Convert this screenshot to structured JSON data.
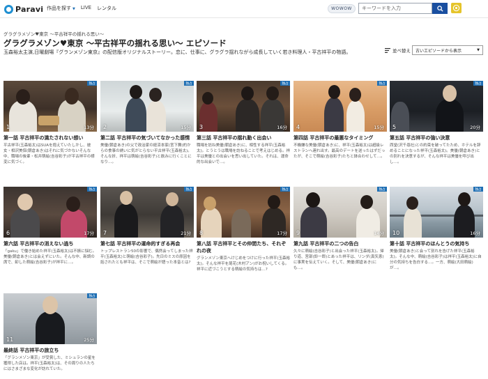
{
  "header": {
    "logo": "Paravi",
    "nav": [
      {
        "label": "作品を探す",
        "has_caret": true
      },
      {
        "label": "LIVE",
        "has_caret": false
      },
      {
        "label": "レンタル",
        "has_caret": false
      }
    ],
    "wowow_label": "WOWOW",
    "search_placeholder": "キーワードを入力",
    "icons": {
      "search": "search-icon",
      "user": "user-icon"
    }
  },
  "breadcrumb": "グラグラメゾン♥東京 ～平古祥平の揺れる思い～",
  "page_title": "グラグラメゾン♥東京 ～平古祥平の揺れる思い～ エピソード",
  "description": "玉森裕太主演,日曜劇場『グランメゾン東京』の配信版オリジナルストーリー。恋に、仕事に、グラグラ揺れながら成長していく若き料理人・平古祥平の物語。",
  "sort": {
    "label": "並べ替え",
    "selected": "古いエピソードから表示"
  },
  "badge_label": "独占",
  "colors": {
    "accent": "#1f6fb4",
    "search_button": "#1a4fa0"
  },
  "episodes": [
    {
      "num": "1",
      "duration": "13分",
      "title": "第一話 平古祥平の満たされない想い",
      "desc": "平古祥平(玉森裕太)はSUAを抱えていたしかし、彼女・相沢美保(朝倉あき)はそれに気づかないそんな中、職場の後輩・松井萌絵(吉谷彩子)が平古祥平の様変に気づく。"
    },
    {
      "num": "2",
      "duration": "15分",
      "title": "第二話 平古祥平の気づいてなかった感情",
      "desc": "美優(朝倉あき)の父で政治家の経済本家(宮下舞)的からの食事の誘いに気がとらない平古祥平(玉森裕太)。そんな折、祥平は萌絵(吉谷彩子)と飲みに行くことになり…。"
    },
    {
      "num": "3",
      "duration": "16分",
      "title": "第三話 平古祥平の揺れ動く出会い",
      "desc": "職場を訪ね美優(朝倉あき)に、相性する祥平(玉森裕太)。とうとうは職場を訪ねることで考えはじめる。祥平は美優との出会いを思い出していた。それは、運命的な出会いで…。"
    },
    {
      "num": "4",
      "duration": "15分",
      "title": "第四話 平古祥平の最悪なタイミング",
      "desc": "不機嫌な美優(朝倉あき)に、祥平(玉森裕太)は超級レストランへ連れ出す。最高のデートを送ったはずだったが、そこで萌絵(吉谷彩子)たちと鉢合わせして…。"
    },
    {
      "num": "5",
      "duration": "20分",
      "title": "第五話 平古祥平の強い決意",
      "desc": "西堂(沢千尋社)との約束を破ってたため、ホテルを辞めることになった祥平(玉森裕太)。美優(朝倉あき)との別れを決意するが、そんな祥平は美優を呼び出し…。"
    },
    {
      "num": "6",
      "duration": "17分",
      "title": "第六話 平古祥平の消えない過ち",
      "desc": "「gaku」で働き始めた祥平(玉森裕太)は不振に悩む。美優(朝倉あき)とは会えずにいた。そんな中、新調の席で、卸した萌絵(吉谷彩子)が祥平に…。"
    },
    {
      "num": "7",
      "duration": "21分",
      "title": "第七話 平古祥平の運命的すぎる再会",
      "desc": "トップレストラン50の影響で、偶然会ってしまった祥平(玉森裕太)と萌絵(吉谷彩子)。先日のミスの原因を話されたとも祥平は、そこで萌絵が語った本音とは?"
    },
    {
      "num": "8",
      "duration": "17分",
      "title": "第八話 平古祥平とその仲間たち、それぞれの夜",
      "desc": "グランメゾン東京へけじめをつけに行った祥平(玉森裕太)。そんな祥平を尾花(木村アン)がお祝いしてくる。祥平に近づこうとする萌絵の気持ちは…?"
    },
    {
      "num": "9",
      "duration": "14分",
      "title": "第九話 平古祥平の二つの告白",
      "desc": "久々に萌絵(吉谷彩子)と出会った祥平(玉森裕太)。帰り道、宮部(鈴一郎)とあった祥平は、リンダ(真矢恵)に事実を伝えていく。そして、美優(朝倉あき)にも…。"
    },
    {
      "num": "10",
      "duration": "16分",
      "title": "第十話 平古祥平のほんとうの気持ち",
      "desc": "美優(朝倉あき)と会って別れを告げた祥平(玉森裕太)。そんな中、萌絵(吉谷彩子)は祥平(玉森裕太)に自分の気持ちを告白する…。一方、萌絵(大田萌絵)が…。"
    },
    {
      "num": "11",
      "duration": "25分",
      "title": "最終話 平古祥平の旅立ち",
      "desc": "「グランメゾン東京」が受賞した、ミシュランの星を獲得した店は。祥平(玉森裕太)は、その周りの人たちにはさまざまな変化が訪れていた。"
    }
  ]
}
